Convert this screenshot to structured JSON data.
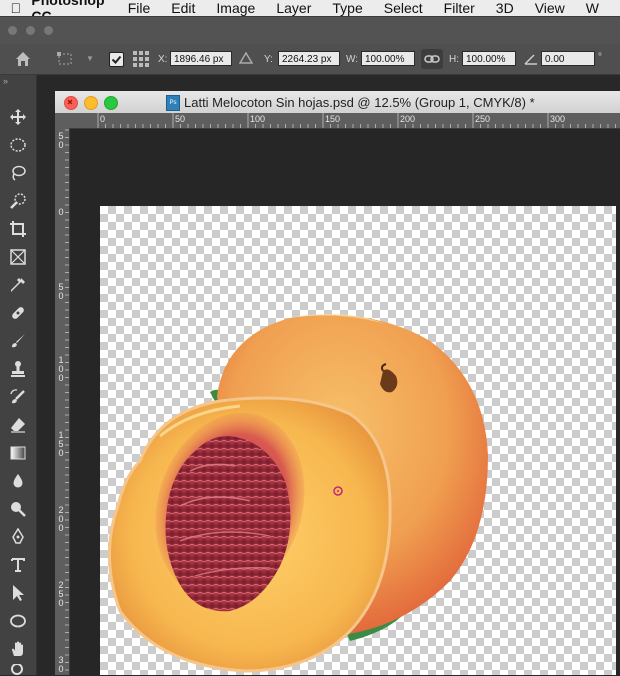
{
  "menubar": {
    "app_name": "Photoshop CC",
    "items": [
      "File",
      "Edit",
      "Image",
      "Layer",
      "Type",
      "Select",
      "Filter",
      "3D",
      "View",
      "W"
    ]
  },
  "options": {
    "x_label": "X:",
    "x_value": "1896.46 px",
    "y_label": "Y:",
    "y_value": "2264.23 px",
    "w_label": "W:",
    "w_value": "100.00%",
    "h_label": "H:",
    "h_value": "100.00%",
    "angle_value": "0.00",
    "angle_unit": "°"
  },
  "document": {
    "title": "Latti Melocoton Sin hojas.psd @ 12.5% (Group 1, CMYK/8) *",
    "ruler_h_labels": [
      "0",
      "50",
      "100",
      "150",
      "200",
      "250",
      "300"
    ],
    "ruler_v_labels": [
      "5\n0",
      "0",
      "5\n0",
      "1\n0\n0",
      "1\n5\n0",
      "2\n0\n0",
      "2\n5\n0",
      "3\n0"
    ],
    "tab_icon": "psd-file-icon"
  },
  "colors": {
    "accent_close": "#fc5f57",
    "accent_min": "#fdbc2e",
    "accent_max": "#29c840"
  }
}
